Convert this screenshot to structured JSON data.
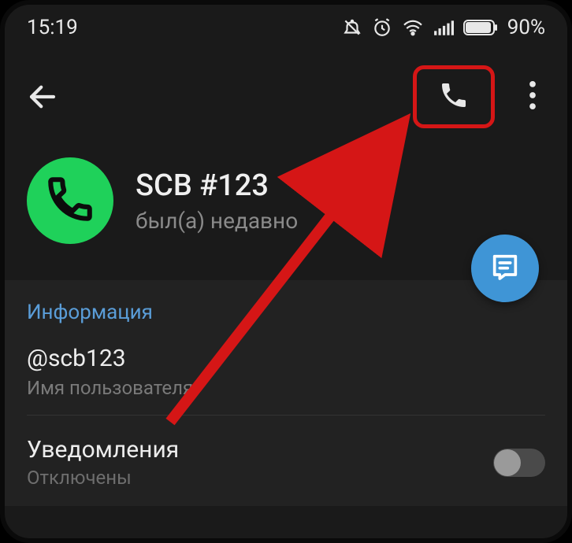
{
  "statusbar": {
    "time": "15:19",
    "battery_percent": "90%"
  },
  "profile": {
    "name": "SCB #123",
    "last_seen": "был(а) недавно"
  },
  "info": {
    "header": "Информация",
    "username_value": "@scb123",
    "username_label": "Имя пользователя"
  },
  "notifications": {
    "title": "Уведомления",
    "status": "Отключены"
  }
}
